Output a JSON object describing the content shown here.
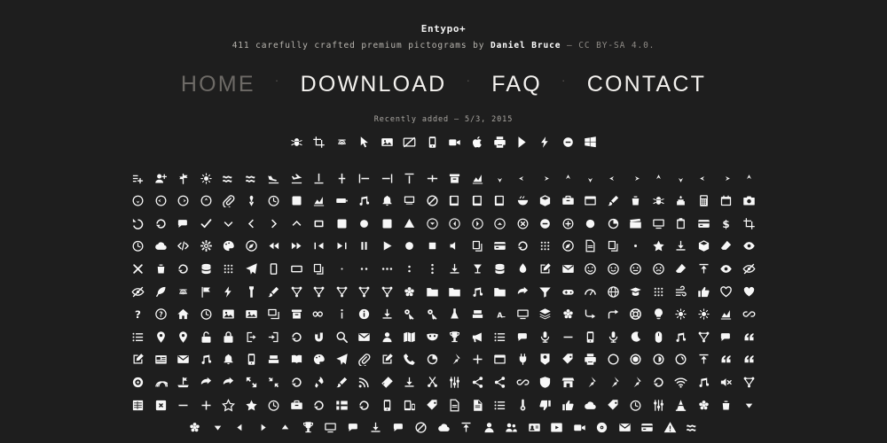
{
  "theme": {
    "background": "#1e1e1e",
    "icon_color": "#f7f7f7",
    "muted_text": "#6d6a66",
    "body_text": "#b9b6b0"
  },
  "header": {
    "title": "Entypo+",
    "tagline_prefix": "411 carefully crafted premium pictograms by ",
    "author": "Daniel Bruce",
    "tagline_suffix": " — CC BY-SA 4.0."
  },
  "nav": {
    "separator": "·",
    "items": [
      {
        "label": "HOME",
        "state": "muted"
      },
      {
        "label": "DOWNLOAD",
        "state": "active"
      },
      {
        "label": "FAQ",
        "state": "active"
      },
      {
        "label": "CONTACT",
        "state": "active"
      }
    ]
  },
  "recent": {
    "label": "Recently added — 5/3, 2015",
    "icons": [
      "bug-icon",
      "crop-icon",
      "fingerprint-icon",
      "cursor-arrow-icon",
      "image-badge-icon",
      "no-image-icon",
      "tablet-mobile-icon",
      "video-camera-icon",
      "apple-logo-icon",
      "paw-print-icon",
      "google-play-icon",
      "flash-icon",
      "minus-circle-icon",
      "windows-logo-icon"
    ]
  },
  "grid": {
    "columns": 28,
    "rows": [
      {
        "offset": 0,
        "icons": [
          "add-to-list-icon",
          "add-user-icon",
          "signpost-icon",
          "brightness-icon",
          "water-waves-icon",
          "air-icon",
          "flight-land-icon",
          "flight-takeoff-icon",
          "align-bottom-icon",
          "align-horizontal-middle-icon",
          "align-left-icon",
          "align-right-icon",
          "align-top-icon",
          "align-vertical-middle-icon",
          "archive-icon",
          "area-graph-icon",
          "arrow-bold-down-icon",
          "arrow-bold-left-icon",
          "arrow-bold-right-icon",
          "arrow-bold-up-icon",
          "arrow-down-icon",
          "arrow-left-icon",
          "arrow-right-icon",
          "arrow-up-icon",
          "arrow-long-down-icon",
          "arrow-long-left-icon",
          "arrow-long-right-icon",
          "arrow-long-up-icon"
        ]
      },
      {
        "offset": 0,
        "icons": [
          "circle-down-icon",
          "circle-left-icon",
          "circle-right-icon",
          "circle-up-icon",
          "attachment-icon",
          "awareness-ribbon-icon",
          "back-in-time-icon",
          "back-icon",
          "bar-graph-icon",
          "battery-icon",
          "beamed-note-icon",
          "bell-icon",
          "blackboard-icon",
          "block-icon",
          "book-icon",
          "bookmark-icon",
          "bookmarks-icon",
          "bowl-icon",
          "box-icon",
          "briefcase-icon",
          "browser-icon",
          "brush-icon",
          "bucket-icon",
          "bug-icon",
          "cake-icon",
          "calculator-icon",
          "calendar-icon",
          "camera-icon"
        ]
      },
      {
        "offset": 0,
        "icons": [
          "ccw-icon",
          "cw-icon",
          "chat-icon",
          "check-icon",
          "chevron-down-icon",
          "chevron-left-icon",
          "chevron-right-icon",
          "chevron-up-icon",
          "chevron-small-down-icon",
          "chevron-small-left-icon",
          "chevron-small-right-icon",
          "chevron-small-up-icon",
          "chevron-thin-down-icon",
          "chevron-circle-down-icon",
          "chevron-circle-left-icon",
          "chevron-circle-right-icon",
          "chevron-circle-up-icon",
          "circle-cross-icon",
          "circle-minus-icon",
          "circle-plus-icon",
          "circle-icon",
          "circular-graph-icon",
          "clapperboard-icon",
          "classic-computer-icon",
          "clipboard-icon",
          "credit-card-icon",
          "dollar-icon",
          "crop-icon"
        ]
      },
      {
        "offset": 0,
        "icons": [
          "clock-icon",
          "cloud-icon",
          "code-icon",
          "cog-icon",
          "colours-icon",
          "compass-icon",
          "controller-fast-backward-icon",
          "controller-fast-forward-icon",
          "controller-jump-to-start-icon",
          "controller-next-icon",
          "controller-paus-icon",
          "controller-play-icon",
          "controller-record-icon",
          "controller-stop-icon",
          "controller-volume-icon",
          "copy-icon",
          "credit-icon",
          "cycle-icon",
          "dial-pad-icon",
          "direction-icon",
          "document-icon",
          "documents-icon",
          "dot-single-icon",
          "dots-two-icon",
          "download-icon",
          "box-icon-2",
          "eraser-icon",
          "eye-icon"
        ]
      },
      {
        "offset": 0,
        "icons": [
          "cross-icon",
          "trash-icon",
          "cycle-icon-2",
          "database-icon",
          "grid-icon",
          "paper-plane-icon",
          "rectangle-portrait-icon",
          "rectangle-landscape-icon",
          "documents-stack-icon",
          "dot-single-small-icon",
          "dots-two-horizontal-icon",
          "dots-three-horizontal-icon",
          "dots-two-vertical-icon",
          "dots-three-vertical-icon",
          "download-tray-icon",
          "drink-icon",
          "drive-icon",
          "drop-icon",
          "edit-icon",
          "email-icon",
          "emoji-flirt-icon",
          "emoji-happy-icon",
          "emoji-neutral-icon",
          "emoji-sad-icon",
          "erase-icon",
          "export-icon",
          "eye-view-icon",
          "eye-hidden-icon"
        ]
      },
      {
        "offset": 0,
        "icons": [
          "eye-with-line-icon",
          "feather-icon",
          "fingerprint-icon",
          "flag-icon",
          "flash-icon",
          "flashlight-icon",
          "flat-brush-icon",
          "flow-branch-icon",
          "flow-cascade-icon",
          "flow-line-icon",
          "flow-parallel-icon",
          "flow-tree-icon",
          "flower-icon",
          "folder-icon",
          "folder-images-icon",
          "folder-music-icon",
          "folder-video-icon",
          "forward-icon",
          "funnel-icon",
          "game-controller-icon",
          "gauge-icon",
          "globe-icon",
          "graduation-cap-icon",
          "grid-squares-icon",
          "hair-cross-icon",
          "hand-icon",
          "heart-outlined-icon",
          "heart-icon"
        ]
      },
      {
        "offset": 0,
        "icons": [
          "help-icon",
          "help-with-circle-icon",
          "home-icon",
          "hour-glass-icon",
          "image-icon",
          "image-inverted-icon",
          "images-icon",
          "inbox-icon",
          "infinity-icon",
          "info-icon",
          "info-with-circle-icon",
          "install-icon",
          "key-icon",
          "keyboard-icon",
          "lab-flask-icon",
          "landline-icon",
          "language-icon",
          "laptop-icon",
          "layers-icon",
          "leaf-icon",
          "level-down-icon",
          "level-up-icon",
          "lifebuoy-icon",
          "light-bulb-icon",
          "light-down-icon",
          "light-up-icon",
          "line-graph-icon",
          "link-icon"
        ]
      },
      {
        "offset": 0,
        "icons": [
          "list-icon",
          "location-pin-icon",
          "location-icon",
          "lock-open-icon",
          "lock-icon",
          "log-out-icon",
          "login-icon",
          "loop-icon",
          "magnet-icon",
          "magnifying-glass-icon",
          "mail-icon",
          "man-icon",
          "map-icon",
          "mask-icon",
          "medal-icon",
          "megaphone-icon",
          "menu-icon",
          "message-icon",
          "mic-icon",
          "minus-icon",
          "mobile-icon",
          "modern-mic-icon",
          "moon-icon",
          "mouse-icon",
          "music-icon",
          "network-icon",
          "new-message-icon",
          "quote-icon"
        ]
      },
      {
        "offset": 0,
        "icons": [
          "new-icon",
          "news-icon",
          "newsletter-icon",
          "note-icon",
          "notification-icon",
          "old-mobile-icon",
          "old-phone-icon",
          "open-book-icon",
          "palette-icon",
          "paper-plane-2-icon",
          "paperclip-icon",
          "pencil-icon",
          "phone-icon",
          "pie-chart-icon",
          "pin-icon",
          "plus-icon",
          "popup-icon",
          "power-plug-icon",
          "price-ribbon-icon",
          "price-tag-icon",
          "print-icon",
          "progress-empty-icon",
          "progress-full-icon",
          "progress-one-icon",
          "progress-two-icon",
          "publish-icon",
          "quote-left-icon",
          "quote-right-icon"
        ]
      },
      {
        "offset": 0,
        "icons": [
          "radio-icon",
          "rainbow-icon",
          "raft-icon",
          "reply-all-icon",
          "reply-icon",
          "resize-full-icon",
          "resize-small-icon",
          "retweet-icon",
          "rocket-icon",
          "round-brush-icon",
          "rss-icon",
          "ruler-icon",
          "save-icon",
          "scissors-icon",
          "sound-mix-icon",
          "share-alternative-icon",
          "share-icon",
          "shareable-icon",
          "shield-icon",
          "shop-icon",
          "shopping-bag-icon",
          "shopping-basket-icon",
          "shopping-cart-icon",
          "shuffle-icon",
          "signal-icon",
          "sound-icon",
          "sound-mute-icon",
          "sports-club-icon"
        ]
      },
      {
        "offset": 0,
        "icons": [
          "spreadsheet-icon",
          "squared-cross-icon",
          "squared-minus-icon",
          "squared-plus-icon",
          "star-outlined-icon",
          "star-icon",
          "stopwatch-icon",
          "suitcase-icon",
          "swap-icon",
          "sweden-icon",
          "switch-icon",
          "tablet-icon",
          "tablet-mobile-combo-icon",
          "tag-icon",
          "text-document-icon",
          "text-document-inverted-icon",
          "text-icon",
          "thermometer-icon",
          "thumbs-down-icon",
          "thumbs-up-icon",
          "thunder-cloud-icon",
          "ticket-icon",
          "time-slot-icon",
          "tools-icon",
          "traffic-cone-icon",
          "tree-icon",
          "trash-can-icon",
          "triangle-down-icon"
        ]
      },
      {
        "offset": 3,
        "icons": [
          "tree-icon-2",
          "triangle-down-icon",
          "triangle-left-icon",
          "triangle-right-icon",
          "triangle-up-icon",
          "trophy-icon",
          "tv-icon",
          "typing-icon",
          "uninstall-icon",
          "unread-icon",
          "untag-icon",
          "upload-to-cloud-icon",
          "upload-icon",
          "user-icon",
          "users-icon",
          "v-card-icon",
          "video-icon",
          "video-camera-icon",
          "vinyl-icon",
          "voicemail-icon",
          "wallet-icon",
          "warning-icon",
          "water-icon"
        ]
      }
    ]
  }
}
